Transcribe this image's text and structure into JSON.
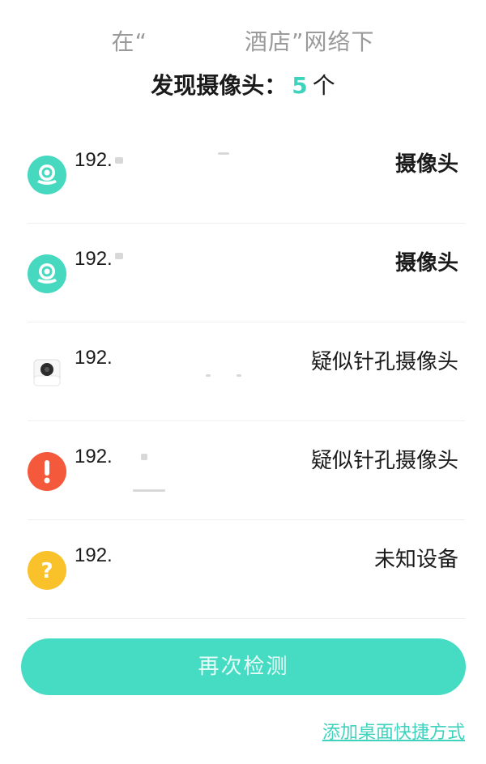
{
  "header": {
    "network_prefix": "在“",
    "network_suffix": "酒店”网络下",
    "found_label": "发现摄像头：",
    "found_count": "5",
    "found_unit": "个"
  },
  "devices": [
    {
      "ip": "192.",
      "type": "摄像头",
      "icon": "camera-app-icon",
      "icon_color": "#46d9c0"
    },
    {
      "ip": "192.",
      "type": "摄像头",
      "icon": "camera-app-icon",
      "icon_color": "#46d9c0"
    },
    {
      "ip": "192.",
      "type": "疑似针孔摄像头",
      "icon": "home-camera-icon",
      "icon_color": "#ffffff"
    },
    {
      "ip": "192.",
      "type": "疑似针孔摄像头",
      "icon": "warning-icon",
      "icon_color": "#f4593c"
    },
    {
      "ip": "192.",
      "type": "未知设备",
      "icon": "question-icon",
      "icon_color": "#f9c22a"
    }
  ],
  "actions": {
    "recheck_label": "再次检测",
    "shortcut_label": "添加桌面快捷方式"
  },
  "colors": {
    "accent": "#46dcc3",
    "link": "#3fd3bd"
  }
}
